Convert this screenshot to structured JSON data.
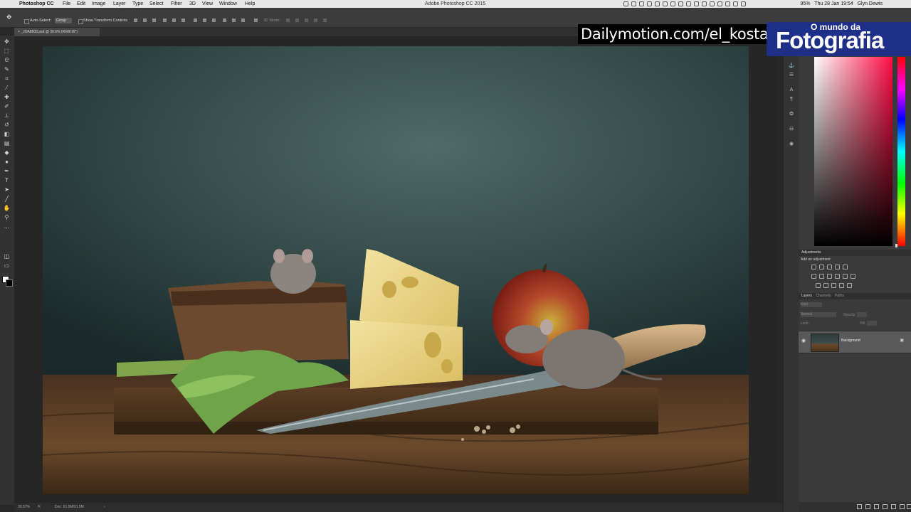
{
  "menubar": {
    "app_name": "Photoshop CC",
    "items": [
      "File",
      "Edit",
      "Image",
      "Layer",
      "Type",
      "Select",
      "Filter",
      "3D",
      "View",
      "Window",
      "Help"
    ],
    "window_title": "Adobe Photoshop CC 2015",
    "battery": "95%",
    "clock": "Thu 28 Jan  19:54",
    "user": "Glyn Dewis"
  },
  "options_bar": {
    "auto_select_label": "Auto-Select:",
    "auto_select_value": "Group",
    "show_transform_label": "Show Transform Controls",
    "mode_3d_label": "3D Mode:"
  },
  "document": {
    "tab_title": "_JOA8508.psd @ 39.6% (RGB/16*)",
    "zoom": "39.57%",
    "doc_info": "Doc: 91.5M/91.5M"
  },
  "panels": {
    "adjustments": {
      "title": "Adjustments",
      "subtitle": "Add an adjustment"
    },
    "layers": {
      "tabs": [
        "Layers",
        "Channels",
        "Paths"
      ],
      "kind_label": "Kind",
      "blend_mode": "Normal",
      "opacity_label": "Opacity:",
      "lock_label": "Lock:",
      "fill_label": "Fill:",
      "items": [
        {
          "name": "Background",
          "visible": true,
          "locked": true
        }
      ]
    }
  },
  "watermarks": {
    "url_text": "Dailymotion.com/el_kosta",
    "logo_small": "O mundo da",
    "logo_big": "Fotografia"
  },
  "colors": {
    "picker_hue": "#ff0d44",
    "ui_panel": "#3a3a3a",
    "logo_bg": "#1d2f86"
  }
}
